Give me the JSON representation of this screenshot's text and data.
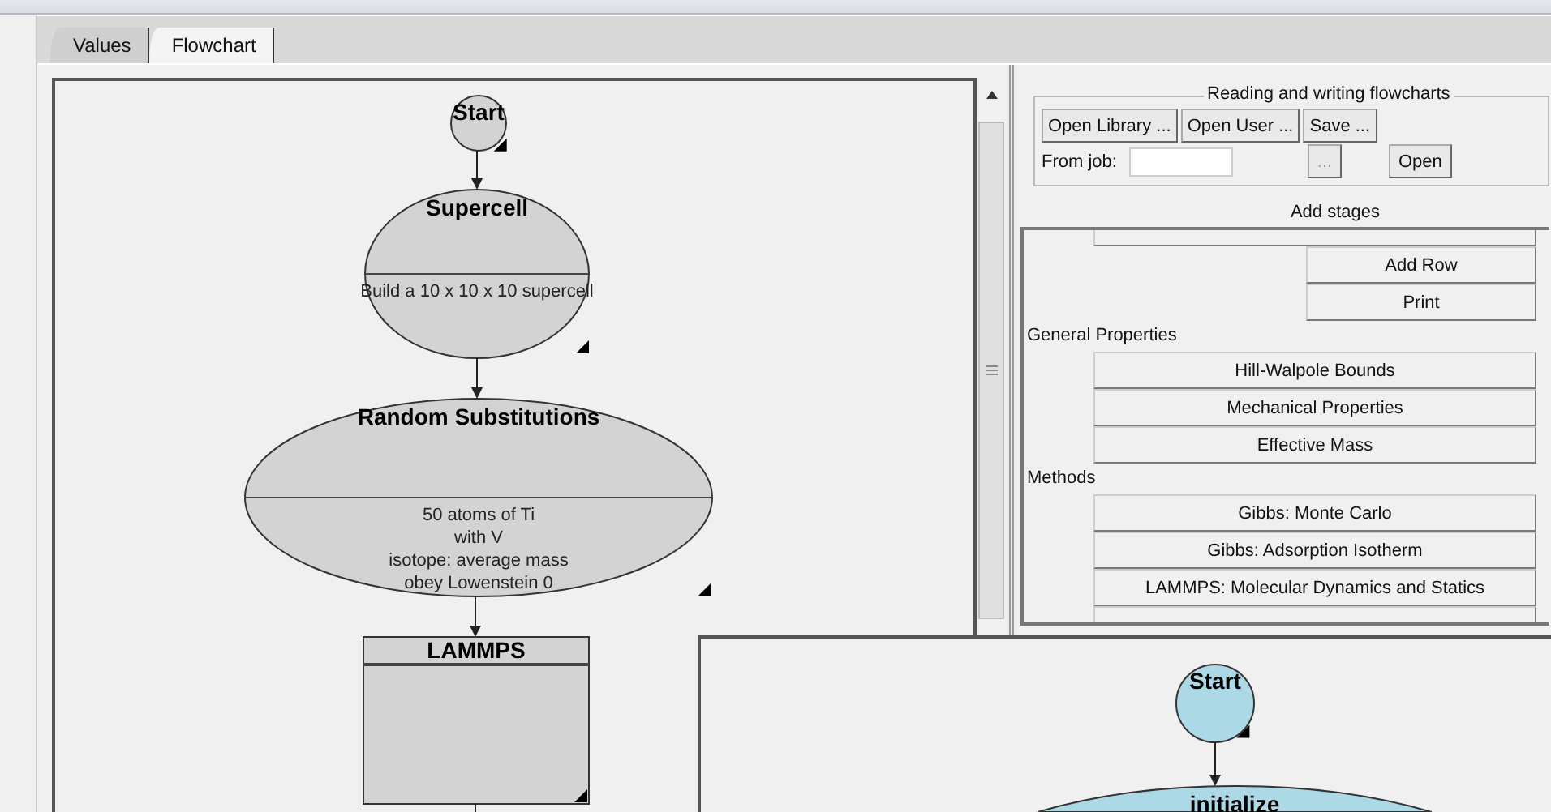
{
  "tabs": [
    {
      "label": "Values",
      "selected": false
    },
    {
      "label": "Flowchart",
      "selected": true
    }
  ],
  "flowchart": {
    "nodes": [
      {
        "kind": "start",
        "title": "Start"
      },
      {
        "kind": "ellipse",
        "title": "Supercell",
        "details": [
          "Build a 10 x 10 x 10 supercell"
        ]
      },
      {
        "kind": "ellipse",
        "title": "Random Substitutions",
        "details": [
          "50 atoms of Ti",
          "with V",
          "isotope: average mass",
          "obey Lowenstein 0"
        ]
      },
      {
        "kind": "box",
        "title": "LAMMPS"
      }
    ]
  },
  "file_group": {
    "title": "Reading and writing flowcharts",
    "buttons": [
      "Open Library ...",
      "Open User ...",
      "Save ..."
    ],
    "job_label": "From job:",
    "browse_button": "...",
    "open_button": "Open"
  },
  "stages": {
    "title": "Add stages",
    "items": [
      {
        "kind": "partial-button"
      },
      {
        "kind": "short-button",
        "label": "Add Row"
      },
      {
        "kind": "short-button",
        "label": "Print"
      },
      {
        "kind": "heading",
        "label": "General Properties"
      },
      {
        "kind": "wide-button",
        "label": "Hill-Walpole Bounds"
      },
      {
        "kind": "wide-button",
        "label": "Mechanical Properties"
      },
      {
        "kind": "wide-button",
        "label": "Effective Mass"
      },
      {
        "kind": "heading",
        "label": "Methods"
      },
      {
        "kind": "wide-button",
        "label": "Gibbs: Monte Carlo"
      },
      {
        "kind": "wide-button",
        "label": "Gibbs: Adsorption Isotherm"
      },
      {
        "kind": "wide-button",
        "label": "LAMMPS: Molecular Dynamics and Statics"
      },
      {
        "kind": "partial-button"
      }
    ]
  },
  "overlay": {
    "nodes": [
      {
        "kind": "start",
        "title": "Start"
      },
      {
        "kind": "ellipse",
        "title": "initialize"
      }
    ]
  }
}
